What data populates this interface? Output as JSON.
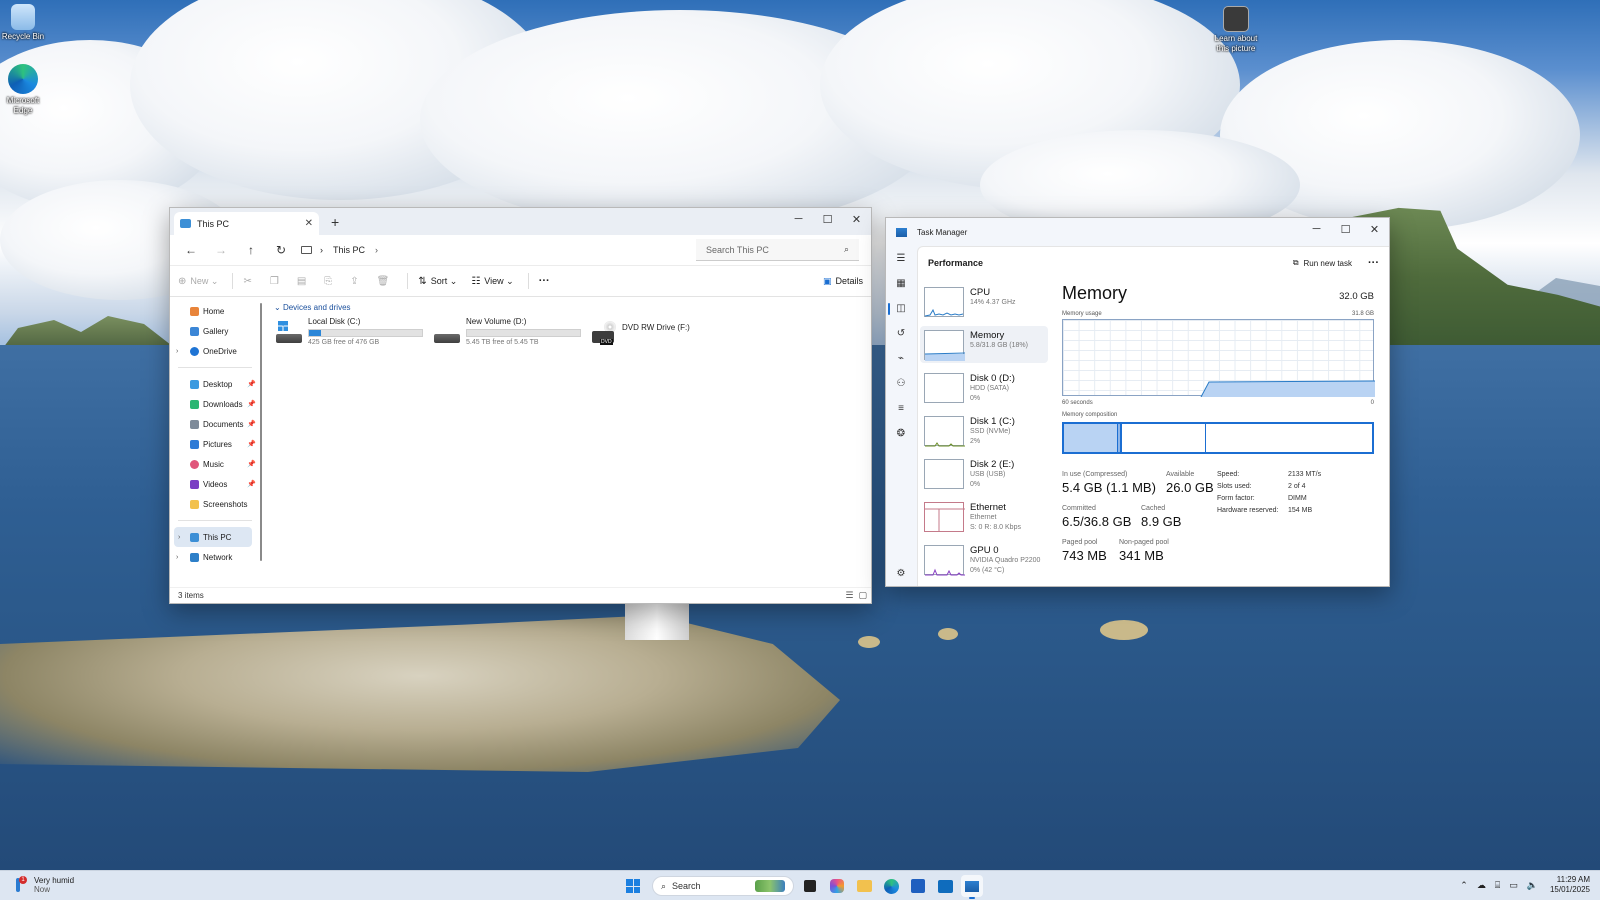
{
  "desktop": {
    "icons": [
      {
        "label": "Recycle Bin"
      },
      {
        "label": "Microsoft Edge"
      },
      {
        "label": "Learn about this picture"
      }
    ]
  },
  "explorer": {
    "tab_title": "This PC",
    "breadcrumb": "This PC",
    "search_placeholder": "Search This PC",
    "toolbar": {
      "new": "New",
      "sort": "Sort",
      "view": "View",
      "more": "···",
      "details": "Details"
    },
    "sidebar": {
      "home": "Home",
      "gallery": "Gallery",
      "onedrive": "OneDrive",
      "desktop": "Desktop",
      "downloads": "Downloads",
      "documents": "Documents",
      "pictures": "Pictures",
      "music": "Music",
      "videos": "Videos",
      "screenshots": "Screenshots",
      "this_pc": "This PC",
      "network": "Network"
    },
    "group_label": "Devices and drives",
    "drives": [
      {
        "name": "Local Disk (C:)",
        "free": "425 GB free of 476 GB",
        "used_fraction": 0.107
      },
      {
        "name": "New Volume (D:)",
        "free": "5.45 TB free of 5.45 TB",
        "used_fraction": 0.0
      },
      {
        "name": "DVD RW Drive (F:)",
        "badge": "DVD"
      }
    ],
    "status": "3 items"
  },
  "taskmgr": {
    "title": "Task Manager",
    "page": "Performance",
    "run_new_task": "Run new task",
    "more": "···",
    "items": [
      {
        "name": "CPU",
        "sub1": "14% 4.37 GHz",
        "sub2": ""
      },
      {
        "name": "Memory",
        "sub1": "5.8/31.8 GB (18%)",
        "sub2": ""
      },
      {
        "name": "Disk 0 (D:)",
        "sub1": "HDD (SATA)",
        "sub2": "0%"
      },
      {
        "name": "Disk 1 (C:)",
        "sub1": "SSD (NVMe)",
        "sub2": "2%"
      },
      {
        "name": "Disk 2 (E:)",
        "sub1": "USB (USB)",
        "sub2": "0%"
      },
      {
        "name": "Ethernet",
        "sub1": "Ethernet",
        "sub2": "S: 0 R: 8.0 Kbps"
      },
      {
        "name": "GPU 0",
        "sub1": "NVIDIA Quadro P2200",
        "sub2": "0% (42 °C)"
      }
    ],
    "memory": {
      "title": "Memory",
      "total": "32.0 GB",
      "usage_label": "Memory usage",
      "usage_max": "31.8 GB",
      "time_left": "60 seconds",
      "time_right": "0",
      "composition_label": "Memory composition",
      "in_use_label": "In use (Compressed)",
      "in_use": "5.4 GB (1.1 MB)",
      "available_label": "Available",
      "available": "26.0 GB",
      "committed_label": "Committed",
      "committed": "6.5/36.8 GB",
      "cached_label": "Cached",
      "cached": "8.9 GB",
      "paged_label": "Paged pool",
      "paged": "743 MB",
      "nonpaged_label": "Non-paged pool",
      "nonpaged": "341 MB",
      "speed_label": "Speed:",
      "speed": "2133 MT/s",
      "slots_label": "Slots used:",
      "slots": "2 of 4",
      "form_label": "Form factor:",
      "form": "DIMM",
      "hwres_label": "Hardware reserved:",
      "hwres": "154 MB"
    }
  },
  "taskbar": {
    "weather": "Very humid",
    "weather_sub": "Now",
    "weather_badge": "1",
    "search": "Search",
    "time": "11:29 AM",
    "date": "15/01/2025"
  }
}
